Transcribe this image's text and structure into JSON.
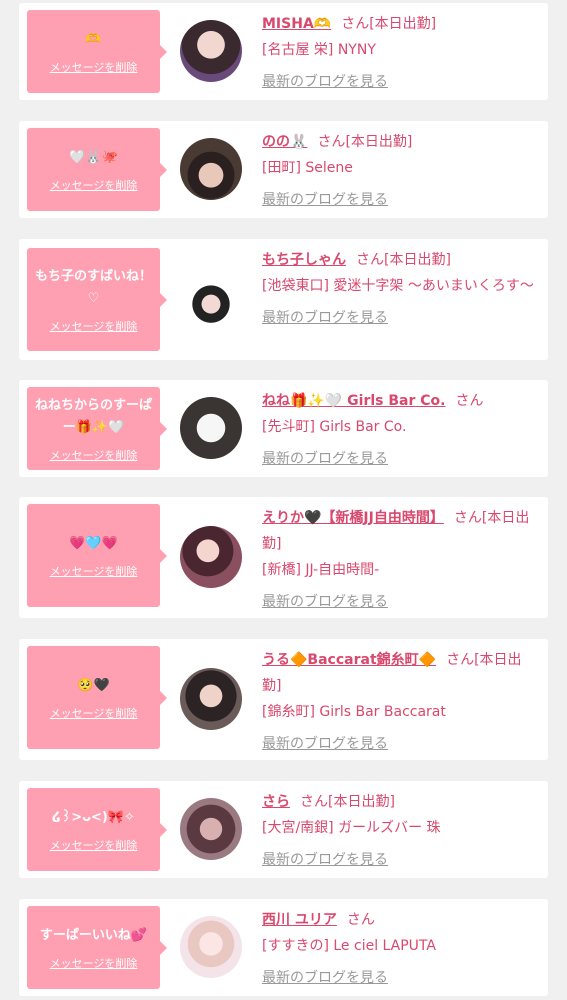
{
  "delete_label": "メッセージを削除",
  "blog_label": "最新のブログを見る",
  "san_label": "さん",
  "accent_color": "#d9486d",
  "bubble_color": "#ffa0b2",
  "items": [
    {
      "message": "🫶",
      "name": "MISHA🫶",
      "status": "[本日出勤]",
      "shop": "[名古屋 栄] NYNY"
    },
    {
      "message": "🤍🐰🐙",
      "name": "のの🐰",
      "status": "[本日出勤]",
      "shop": "[田町] Selene"
    },
    {
      "message": "もち子のすばいね！♡",
      "name": "もち子しゃん",
      "status": "[本日出勤]",
      "shop": "[池袋東口] 愛迷十字架 〜あいまいくろす〜"
    },
    {
      "message": "ねねちからのすーぱー🎁✨🤍",
      "name": "ねね🎁✨🤍 Girls Bar Co.",
      "status": "",
      "shop": "[先斗町] Girls Bar Co."
    },
    {
      "message": "💗🩵💗",
      "name": "えりか🖤【新橋JJ自由時間】",
      "status": "[本日出勤]",
      "shop": "[新橋] JJ-自由時間-"
    },
    {
      "message": "🥺🖤",
      "name": "うる🔶Baccarat錦糸町🔶",
      "status": "[本日出勤]",
      "shop": "[錦糸町] Girls Bar Baccarat"
    },
    {
      "message": "໒꒱>ᴗ<)🎀✧",
      "name": "さら",
      "status": "[本日出勤]",
      "shop": "[大宮/南銀] ガールズバー 珠"
    },
    {
      "message": "すーぱーいいね💕",
      "name": "西川 ユリア",
      "status": "",
      "shop": "[すすきの] Le ciel LAPUTA"
    }
  ]
}
